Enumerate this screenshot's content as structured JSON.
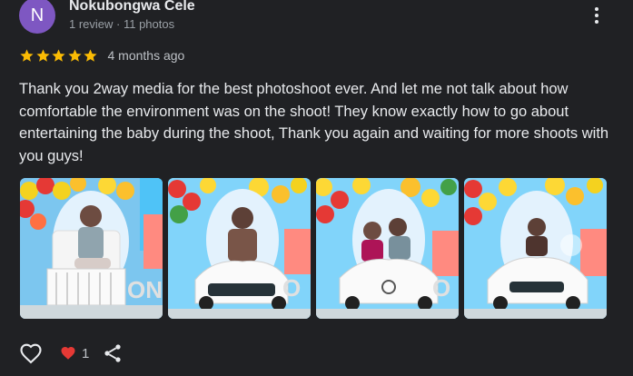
{
  "reviewer": {
    "initial": "N",
    "name": "Nokubongwa Cele",
    "meta": "1 review · 11 photos",
    "avatar_color": "#7e57c2"
  },
  "review": {
    "rating": 5,
    "star_color": "#fbbc04",
    "date": "4 months ago",
    "text": "Thank you 2way media for the best photoshoot ever. And let me not talk about how comfortable the environment was on the shoot! They know exactly how to go about entertaining the baby during the shoot, Thank you again and waiting for more shoots with you guys!"
  },
  "photos": [
    {
      "icon": "photo-baby-on-white-chair"
    },
    {
      "icon": "photo-baby-in-white-toy-car"
    },
    {
      "icon": "photo-babies-in-white-toy-car"
    },
    {
      "icon": "photo-baby-in-white-toy-car-2"
    }
  ],
  "actions": {
    "like_icon": "heart-outline-icon",
    "reaction_icon": "red-heart-icon",
    "reaction_count": "1",
    "reaction_color": "#e53935",
    "share_icon": "share-icon"
  }
}
